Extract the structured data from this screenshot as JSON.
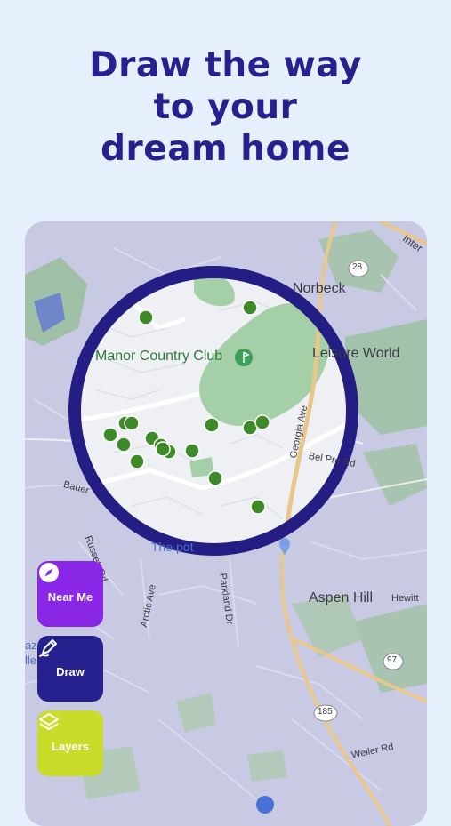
{
  "headline": {
    "line1": "Draw the way",
    "line2": "to your",
    "line3": "dream home"
  },
  "map": {
    "places": {
      "manor_country_club": "Manor Country Club",
      "norbeck": "Norbeck",
      "leisure_world": "Leisure World",
      "aspen_hill": "Aspen Hill",
      "intl_partial": "Inter",
      "lazy_partial_1": "az",
      "lazy_partial_2": "lle"
    },
    "roads": {
      "georgia_ave": "Georgia Ave",
      "bel_pre_rd": "Bel Pre Rd",
      "bauer": "Bauer",
      "russett_rd": "Russett Rd",
      "arctic_ave": "Arctic Ave",
      "parkland_dr": "Parkland Dr",
      "hewitt": "Hewitt",
      "weller_rd": "Weller Rd",
      "depot_partial": "The        pot"
    },
    "route_shields": {
      "r28": "28",
      "r97": "97",
      "r185": "185"
    },
    "listing_pin_count": 17
  },
  "buttons": {
    "near_me": {
      "label": "Near Me",
      "icon": "compass-icon",
      "color": "#8a27e6"
    },
    "draw": {
      "label": "Draw",
      "icon": "pencil-draw-icon",
      "color": "#27208f"
    },
    "layers": {
      "label": "Layers",
      "icon": "layers-icon",
      "color": "#c9dc2a"
    }
  },
  "colors": {
    "background": "#e6f0fd",
    "headline": "#27208f",
    "circle_ring": "#241d84",
    "pin": "#3e8a28"
  }
}
